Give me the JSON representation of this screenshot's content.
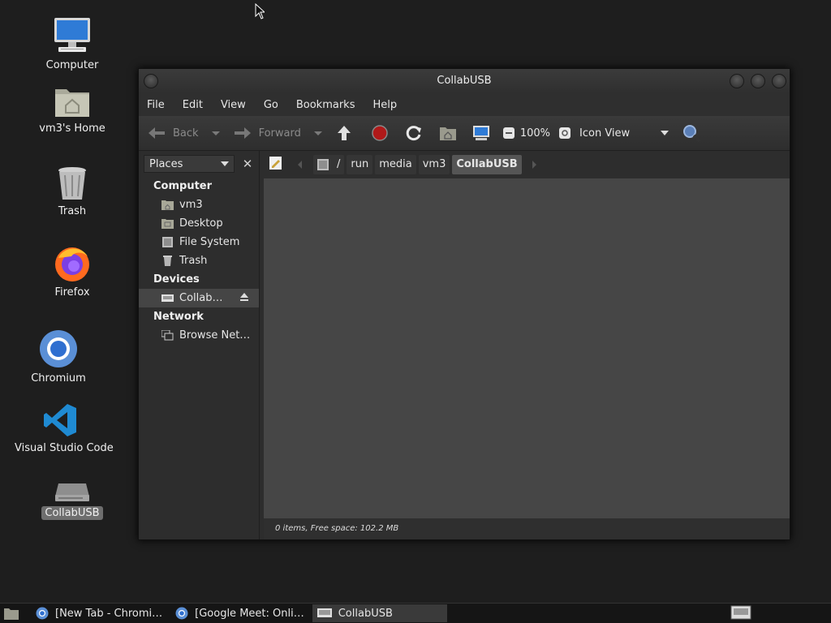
{
  "desktop": {
    "icons": [
      {
        "label": "Computer",
        "icon": "computer-icon"
      },
      {
        "label": "vm3's Home",
        "icon": "home-folder-icon"
      },
      {
        "label": "Trash",
        "icon": "trash-icon"
      },
      {
        "label": "Firefox",
        "icon": "firefox-icon"
      },
      {
        "label": "Chromium",
        "icon": "chromium-icon"
      },
      {
        "label": "Visual Studio Code",
        "icon": "vscode-icon"
      },
      {
        "label": "CollabUSB",
        "icon": "usb-drive-icon",
        "selected": true
      }
    ]
  },
  "window": {
    "title": "CollabUSB",
    "menu": [
      "File",
      "Edit",
      "View",
      "Go",
      "Bookmarks",
      "Help"
    ],
    "toolbar": {
      "back": "Back",
      "forward": "Forward",
      "zoom": "100%",
      "view_mode": "Icon View"
    },
    "sidebar": {
      "selector": "Places",
      "sections": [
        {
          "title": "Computer",
          "items": [
            "vm3",
            "Desktop",
            "File System",
            "Trash"
          ]
        },
        {
          "title": "Devices",
          "items": [
            "Collab…"
          ]
        },
        {
          "title": "Network",
          "items": [
            "Browse Net…"
          ]
        }
      ]
    },
    "path": [
      "run",
      "media",
      "vm3",
      "CollabUSB"
    ],
    "path_root": "/",
    "status": "0 items, Free space: 102.2 MB"
  },
  "taskbar": {
    "tasks": [
      "[New Tab - Chromi…",
      "[Google Meet: Onli…",
      "CollabUSB"
    ]
  },
  "colors": {
    "desktop_bg": "#1e1e1e",
    "view_bg": "#464646",
    "accent_blue": "#2f7bd6"
  }
}
